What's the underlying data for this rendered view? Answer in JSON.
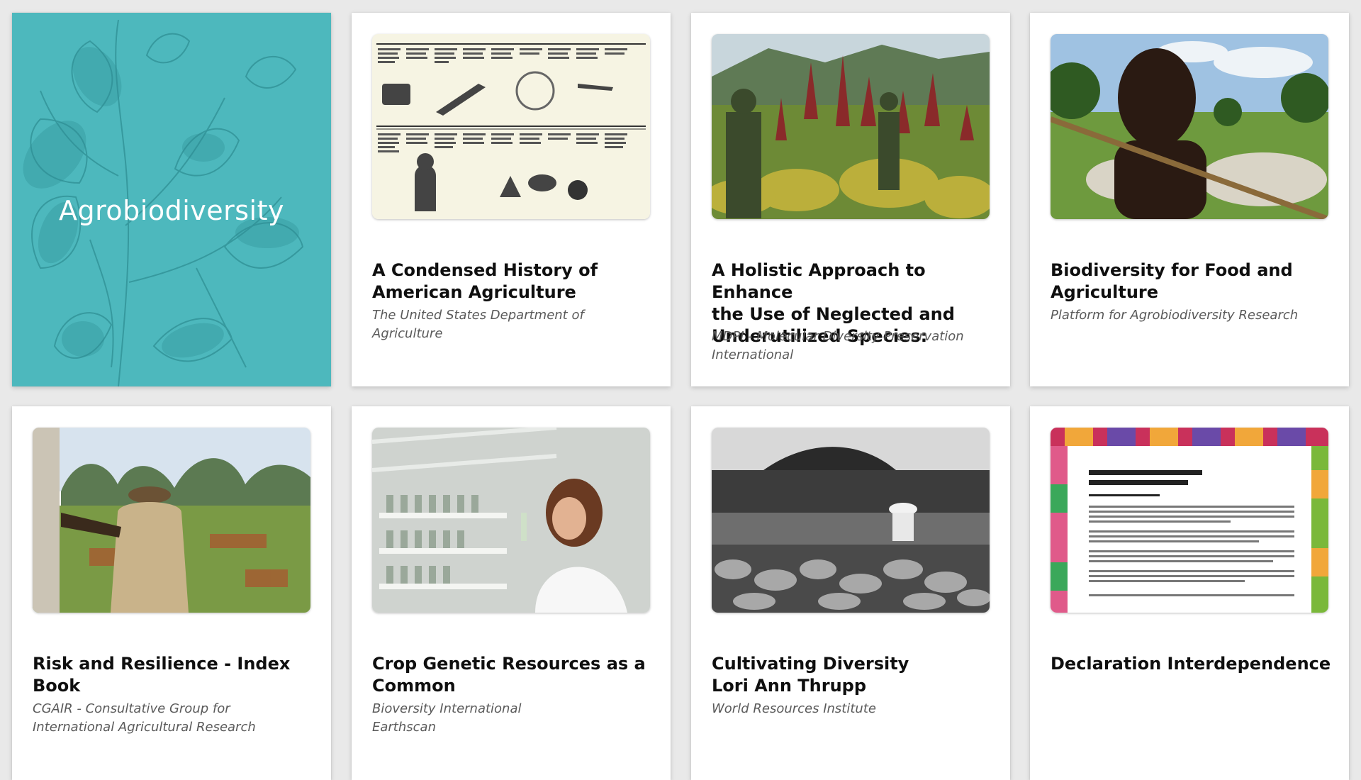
{
  "cover": {
    "title": "Agrobiodiversity",
    "color": "#4db8bd"
  },
  "cards": [
    {
      "title": "A Condensed History of\nAmerican Agriculture",
      "source": "The United States Department of\nAgriculture",
      "thumb": "timeline-chart-image"
    },
    {
      "title": "A Holistic Approach to Enhance\nthe Use of Neglected and\nUnderutilized Species:",
      "source": "MDPI - Molecular Diversity Preservation\nInternational",
      "thumb": "amaranth-field-photo"
    },
    {
      "title": "Biodiversity for Food and\nAgriculture",
      "source": "Platform for Agrobiodiversity Research",
      "thumb": "herder-boy-photo"
    },
    {
      "title": "Risk and Resilience - Index\nBook",
      "source": "CGAIR - Consultative Group for\nInternational Agricultural Research",
      "thumb": "farmer-valley-photo"
    },
    {
      "title": "Crop Genetic Resources as a\nCommon",
      "source": "Bioversity International\nEarthscan",
      "thumb": "lab-scientist-photo"
    },
    {
      "title": "Cultivating Diversity\nLori Ann Thrupp",
      "source": "World Resources Institute",
      "thumb": "field-worker-bw-photo"
    },
    {
      "title": "Declaration Interdependence",
      "source": "",
      "thumb": "declaration-document-image"
    }
  ]
}
